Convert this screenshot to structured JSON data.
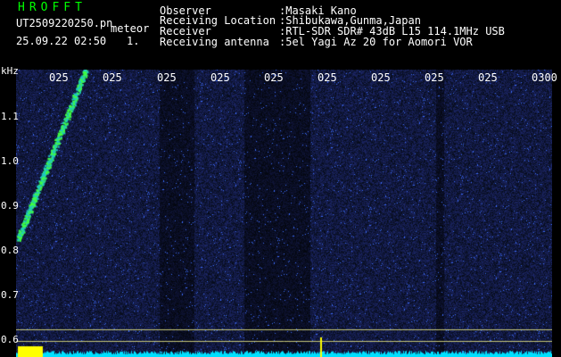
{
  "app": {
    "title": "HROFFT"
  },
  "file": {
    "name": "UT2509220250.pn",
    "tag": "meteor",
    "datetime": "25.09.22 02:50",
    "counter": "1."
  },
  "info": {
    "observer_label": "Observer",
    "observer_value": ":Masaki Kano",
    "location_label": "Receiving Location",
    "location_value": ":Shibukawa,Gunma,Japan",
    "receiver_label": "Receiver",
    "receiver_value": ":RTL-SDR SDR# 43dB L15 114.1MHz USB",
    "antenna_label": "Receiving antenna",
    "antenna_value": ":5el Yagi Az 20 for Aomori VOR"
  },
  "axis": {
    "unit": "kHz",
    "y_ticks": [
      "1.1",
      "1.0",
      "0.9",
      "0.8",
      "0.7",
      "0.6"
    ],
    "x_ticks": [
      "025",
      "025",
      "025",
      "025",
      "025",
      "025",
      "025",
      "025",
      "025",
      "0300"
    ]
  },
  "colors": {
    "background": "#000000",
    "app_title": "#00ff00",
    "waterfall": "#1a2a9a",
    "meteor": "#40ff40",
    "level": "#00ffff",
    "marker": "#ffff00"
  }
}
